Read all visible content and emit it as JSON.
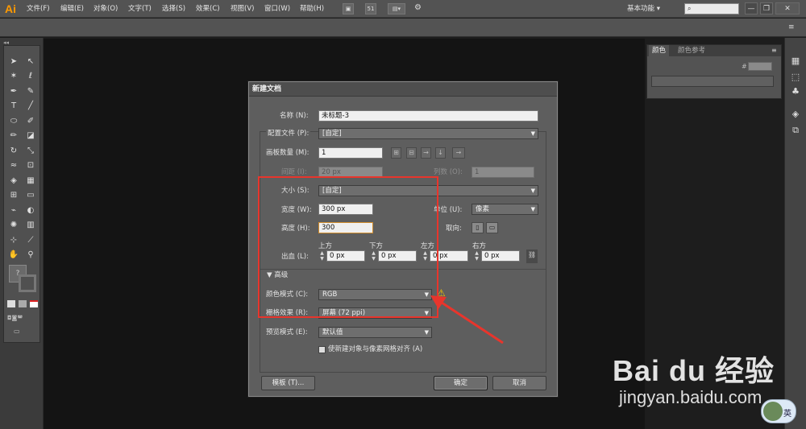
{
  "app": {
    "logo": "Ai"
  },
  "menu": [
    "文件(F)",
    "编辑(E)",
    "对象(O)",
    "文字(T)",
    "选择(S)",
    "效果(C)",
    "视图(V)",
    "窗口(W)",
    "帮助(H)"
  ],
  "toolbar_badge": "51",
  "workspace": "基本功能",
  "search_placeholder": "",
  "window_buttons": {
    "minimize": "—",
    "restore": "❐",
    "close": "✕"
  },
  "color_panel": {
    "tabs": [
      "颜色",
      "颜色参考"
    ],
    "hash": "#"
  },
  "dialog": {
    "title": "新建文档",
    "name_label": "名称 (N):",
    "name_value": "未标题-3",
    "profile_label": "配置文件 (P):",
    "profile_value": "[自定]",
    "artboards_label": "画板数量 (M):",
    "artboards_value": "1",
    "spacing_label": "间距 (I):",
    "spacing_value": "20 px",
    "columns_label": "列数 (O):",
    "columns_value": "1",
    "size_label": "大小 (S):",
    "size_value": "[自定]",
    "width_label": "宽度 (W):",
    "width_value": "300 px",
    "units_label": "单位 (U):",
    "units_value": "像素",
    "height_label": "高度 (H):",
    "height_value": "300",
    "orientation_label": "取向:",
    "bleed_label": "出血 (L):",
    "bleed_headers": [
      "上方",
      "下方",
      "左方",
      "右方"
    ],
    "bleed_values": [
      "0 px",
      "0 px",
      "0 px",
      "0 px"
    ],
    "advanced_label": "高级",
    "colormode_label": "颜色模式 (C):",
    "colormode_value": "RGB",
    "raster_label": "栅格效果 (R):",
    "raster_value": "屏幕 (72 ppi)",
    "preview_label": "预览模式 (E):",
    "preview_value": "默认值",
    "align_label": "使新建对象与像素网格对齐 (A)",
    "template_button": "模板 (T)...",
    "ok_button": "确定",
    "cancel_button": "取消"
  },
  "watermark": {
    "logo": "Bai du 经验",
    "sub": "jingyan.baidu.com"
  },
  "ime": "英",
  "colors": {
    "highlight": "#e8352c",
    "logo": "#ff9a00",
    "warning": "#f2c200"
  }
}
